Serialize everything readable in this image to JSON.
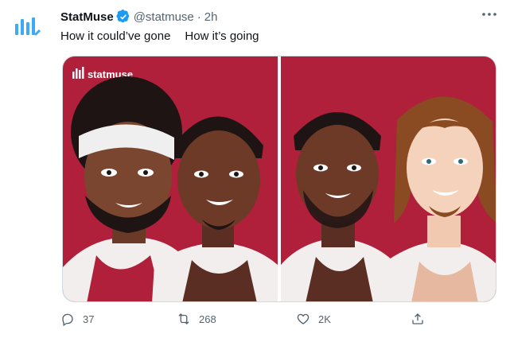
{
  "tweet": {
    "author_name": "StatMuse",
    "handle": "@statmuse",
    "separator": "·",
    "time": "2h",
    "text_part1": "How it could’ve gone",
    "text_part2": "How it’s going"
  },
  "media": {
    "watermark": "statmuse"
  },
  "actions": {
    "reply_count": "37",
    "retweet_count": "268",
    "like_count": "2K"
  },
  "colors": {
    "bg_red": "#b0203a",
    "verified_blue": "#1d9bf0",
    "brand": "#1d9bf0"
  },
  "icons": [
    "statmuse-logo-icon",
    "verified-badge-icon",
    "more-icon",
    "reply-icon",
    "retweet-icon",
    "like-icon",
    "share-icon"
  ]
}
